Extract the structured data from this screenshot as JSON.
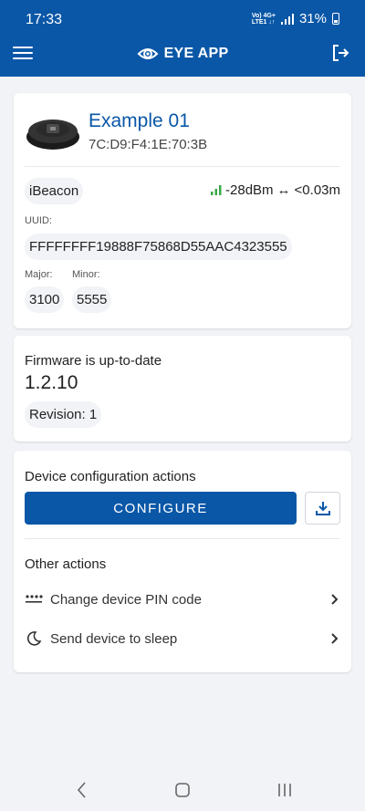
{
  "status_bar": {
    "time": "17:33",
    "network_top": "Vo) 4G+",
    "network_bottom": "LTE1 ↓↑",
    "battery": "31%"
  },
  "app_bar": {
    "title": "EYE APP",
    "menu_icon": "menu-icon",
    "logout_icon": "logout-icon",
    "color": "#0a57a7"
  },
  "device_card": {
    "name": "Example 01",
    "mac": "7C:D9:F4:1E:70:3B",
    "type": "iBeacon",
    "rssi": "-28dBm",
    "distance": "<0.03m",
    "uuid_label": "UUID:",
    "uuid": "FFFFFFFF19888F75868D55AAC4323555",
    "major_label": "Major:",
    "major": "3100",
    "minor_label": "Minor:",
    "minor": "5555"
  },
  "firmware_card": {
    "status": "Firmware is up-to-date",
    "version": "1.2.10",
    "revision": "Revision: 1"
  },
  "actions_card": {
    "config_title": "Device configuration actions",
    "configure_label": "CONFIGURE",
    "download_icon": "download-icon",
    "other_title": "Other actions",
    "items": [
      {
        "label": "Change device PIN code",
        "icon": "pin-dots-icon"
      },
      {
        "label": "Send device to sleep",
        "icon": "moon-icon"
      }
    ]
  },
  "nav_bar": {
    "back_icon": "back-icon",
    "home_icon": "home-icon",
    "recents_icon": "recents-icon"
  }
}
